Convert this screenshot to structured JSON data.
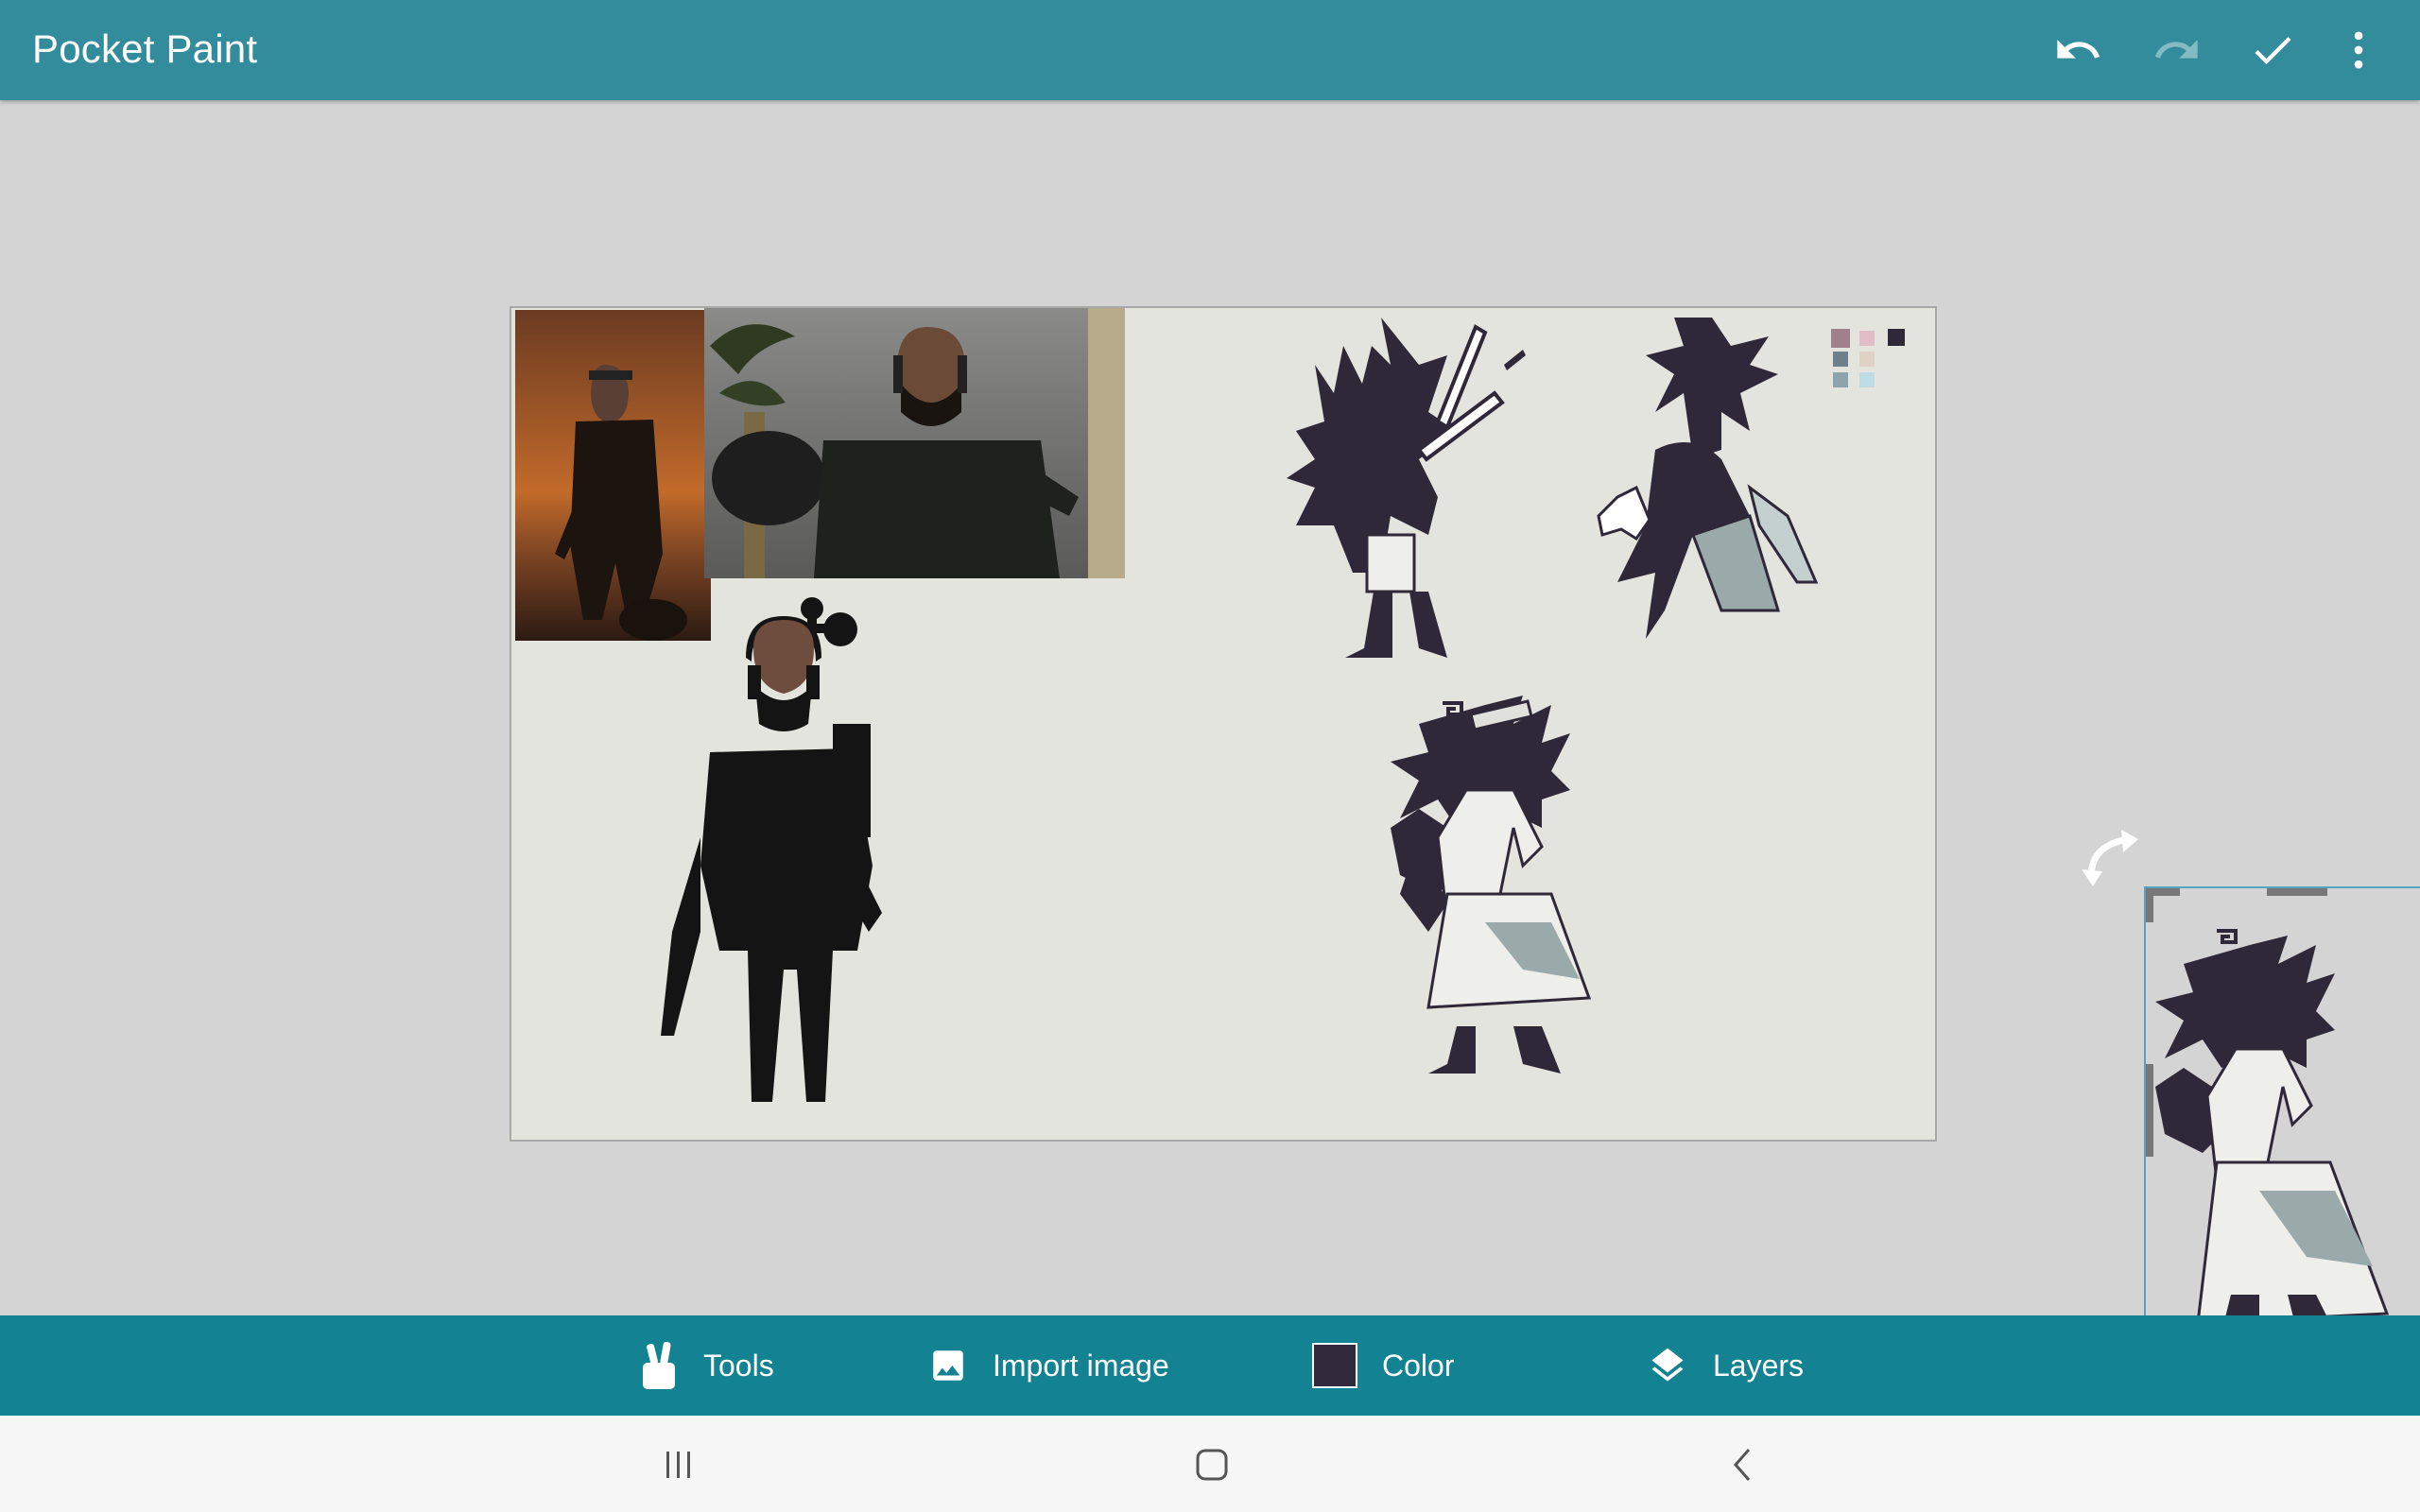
{
  "app_bar": {
    "title": "Pocket Paint",
    "actions": [
      {
        "name": "undo-icon",
        "enabled": true
      },
      {
        "name": "redo-icon",
        "enabled": false
      },
      {
        "name": "checkmark-icon",
        "enabled": true
      },
      {
        "name": "more-vert-icon",
        "enabled": true
      }
    ]
  },
  "bottom_bar": {
    "tools_label": "Tools",
    "import_label": "Import image",
    "color_label": "Color",
    "layers_label": "Layers",
    "current_color": "#33293d"
  },
  "palette_swatches": [
    "#a0818b",
    "#e2bcc6",
    "#2e2838",
    "#6d7f88",
    "#e1d0c4",
    "#8ea4ad",
    "#bcdce6"
  ],
  "colors": {
    "app_bar": "#338c9c",
    "bottom_bar": "#138292",
    "workspace": "#d4d4d4",
    "canvas": "#e4e4df",
    "ink": "#2f2838"
  }
}
